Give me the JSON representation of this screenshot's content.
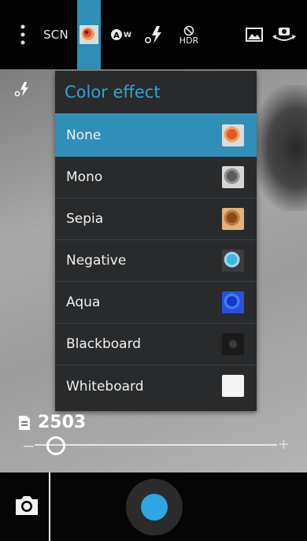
{
  "top_bar": {
    "scene_label": "SCN",
    "awb_label": "AW",
    "hdr_label": "HDR"
  },
  "menu": {
    "title": "Color effect",
    "selected": "None",
    "items": [
      {
        "label": "None"
      },
      {
        "label": "Mono"
      },
      {
        "label": "Sepia"
      },
      {
        "label": "Negative"
      },
      {
        "label": "Aqua"
      },
      {
        "label": "Blackboard"
      },
      {
        "label": "Whiteboard"
      }
    ]
  },
  "exposure": {
    "value": "2503"
  },
  "slider": {
    "minus_label": "−",
    "plus_label": "+",
    "level": 0.05
  },
  "colors": {
    "accent": "#2f8fb8",
    "title": "#35a3d0",
    "shutter": "#2ea7e0"
  }
}
